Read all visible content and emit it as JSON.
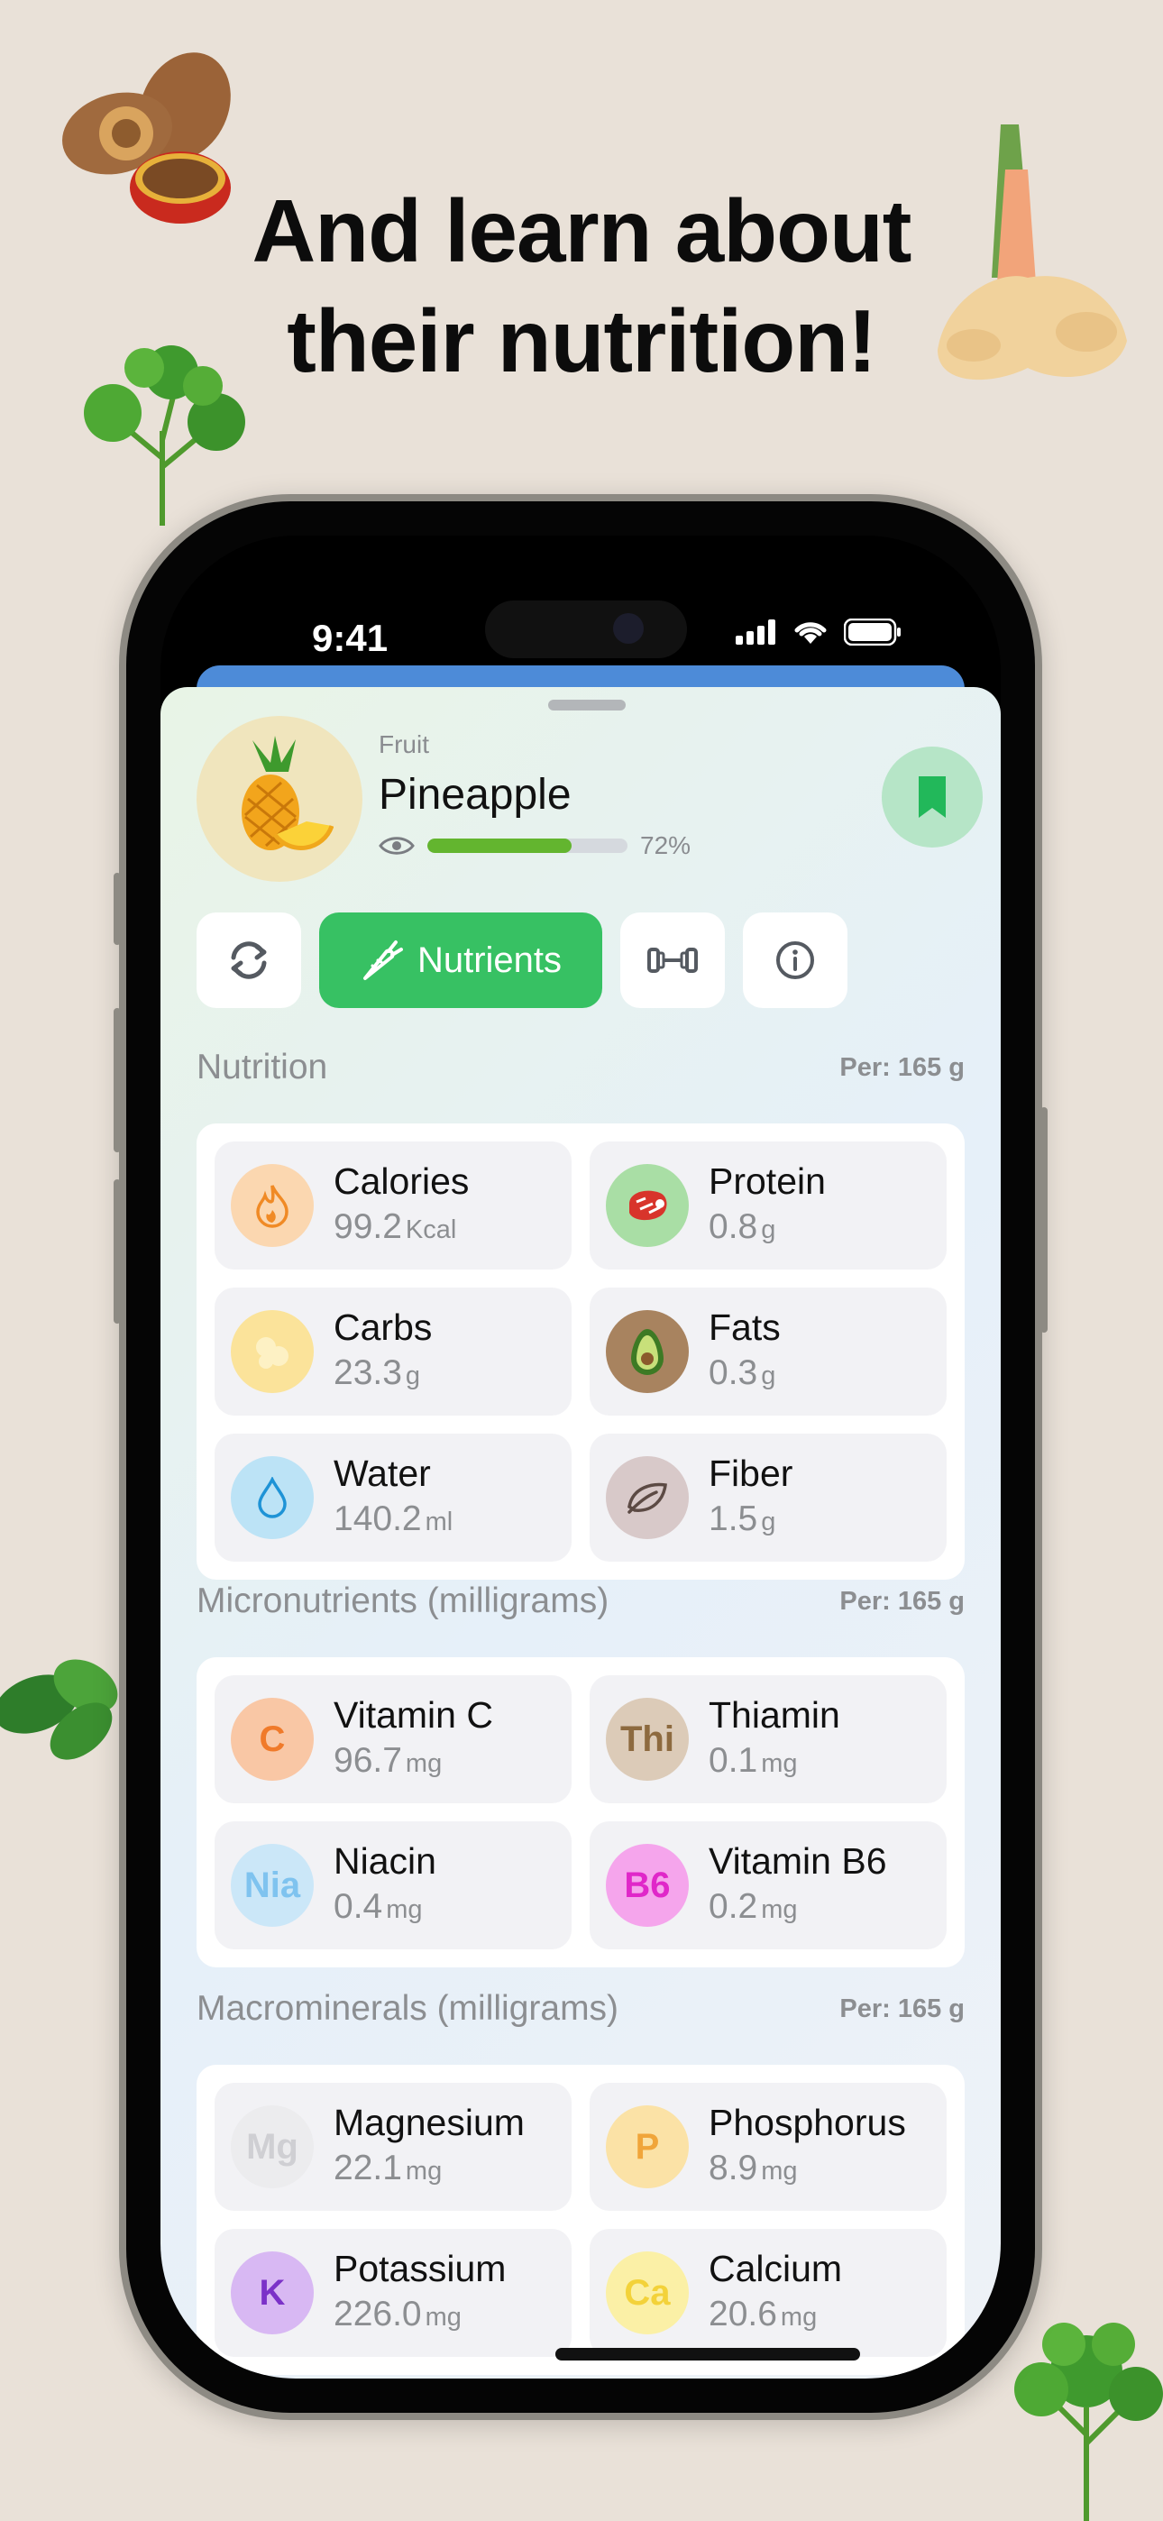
{
  "headline": {
    "line1": "And learn about",
    "line2": "their nutrition!"
  },
  "status": {
    "time": "9:41"
  },
  "food": {
    "category": "Fruit",
    "name": "Pineapple",
    "read_progress": 0.72,
    "read_label": "72%",
    "image_icon": "pineapple-illustration"
  },
  "tabs": [
    {
      "icon": "refresh-icon",
      "label": ""
    },
    {
      "icon": "carrot-icon",
      "label": "Nutrients"
    },
    {
      "icon": "dumbbell-icon",
      "label": ""
    },
    {
      "icon": "info-icon",
      "label": ""
    }
  ],
  "sections": {
    "nutrition": {
      "title": "Nutrition",
      "per": "Per: 165 g",
      "items": [
        {
          "name": "Calories",
          "value": "99.2",
          "unit": "Kcal",
          "icon": "flame-icon",
          "color": "#fbd7b0"
        },
        {
          "name": "Protein",
          "value": "0.8",
          "unit": "g",
          "icon": "steak-icon",
          "color": "#a9dea5"
        },
        {
          "name": "Carbs",
          "value": "23.3",
          "unit": "g",
          "icon": "grain-icon",
          "color": "#fbe39a"
        },
        {
          "name": "Fats",
          "value": "0.3",
          "unit": "g",
          "icon": "avocado-icon",
          "color": "#b08a6a"
        },
        {
          "name": "Water",
          "value": "140.2",
          "unit": "ml",
          "icon": "drop-icon",
          "color": "#bce3f6"
        },
        {
          "name": "Fiber",
          "value": "1.5",
          "unit": "g",
          "icon": "leaf-icon",
          "color": "#d8c9c9"
        }
      ]
    },
    "micronutrients": {
      "title": "Micronutrients (milligrams)",
      "per": "Per: 165 g",
      "items": [
        {
          "name": "Vitamin C",
          "value": "96.7",
          "unit": "mg",
          "badge": "C",
          "color": "#f9c7a5",
          "text_color": "#f07a2a"
        },
        {
          "name": "Thiamin",
          "value": "0.1",
          "unit": "mg",
          "badge": "Thi",
          "color": "#dccbb8",
          "text_color": "#8d6a3f"
        },
        {
          "name": "Niacin",
          "value": "0.4",
          "unit": "mg",
          "badge": "Nia",
          "color": "#cbe7f8",
          "text_color": "#7fc3ef"
        },
        {
          "name": "Vitamin B6",
          "value": "0.2",
          "unit": "mg",
          "badge": "B6",
          "color": "#f5a5ec",
          "text_color": "#e027c9"
        }
      ]
    },
    "macrominerals": {
      "title": "Macrominerals (milligrams)",
      "per": "Per: 165 g",
      "items": [
        {
          "name": "Magnesium",
          "value": "22.1",
          "unit": "mg",
          "badge": "Mg",
          "color": "#ececee",
          "text_color": "#cfcfd3"
        },
        {
          "name": "Phosphorus",
          "value": "8.9",
          "unit": "mg",
          "badge": "P",
          "color": "#fbe2a6",
          "text_color": "#f0a53a"
        },
        {
          "name": "Potassium",
          "value": "226.0",
          "unit": "mg",
          "badge": "K",
          "color": "#d8b8f3",
          "text_color": "#7b31c8"
        },
        {
          "name": "Calcium",
          "value": "20.6",
          "unit": "mg",
          "badge": "Ca",
          "color": "#fbf0a6",
          "text_color": "#f3d23a"
        }
      ]
    }
  }
}
